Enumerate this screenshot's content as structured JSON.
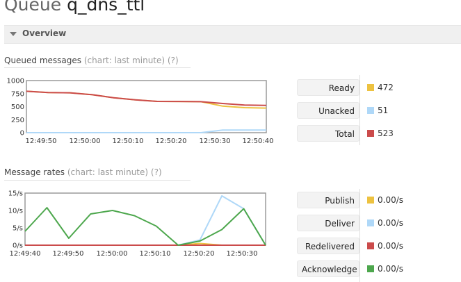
{
  "page": {
    "title_prefix": "Queue",
    "queue_name": "q_dns_ttl"
  },
  "overview": {
    "label": "Overview"
  },
  "queued": {
    "heading": "Queued messages",
    "chart_note": "(chart: last minute)",
    "help": "(?)",
    "legend": [
      {
        "label": "Ready",
        "value": "472",
        "color": "#edc240"
      },
      {
        "label": "Unacked",
        "value": "51",
        "color": "#afd8f8"
      },
      {
        "label": "Total",
        "value": "523",
        "color": "#cb4b4b"
      }
    ]
  },
  "rates": {
    "heading": "Message rates",
    "chart_note": "(chart: last minute)",
    "help": "(?)",
    "legend": [
      {
        "label": "Publish",
        "value": "0.00/s",
        "color": "#edc240"
      },
      {
        "label": "Deliver",
        "value": "0.00/s",
        "color": "#afd8f8"
      },
      {
        "label": "Redelivered",
        "value": "0.00/s",
        "color": "#cb4b4b"
      },
      {
        "label": "Acknowledge",
        "value": "0.00/s",
        "color": "#4da74d"
      }
    ]
  },
  "chart_data": [
    {
      "type": "line",
      "title": "Queued messages",
      "x_ticks": [
        "12:49:50",
        "12:50:00",
        "12:50:10",
        "12:50:20",
        "12:50:30",
        "12:50:40"
      ],
      "y_ticks": [
        "1000",
        "750",
        "500",
        "250",
        "0"
      ],
      "ylim": [
        0,
        1000
      ],
      "x": [
        "12:49:45",
        "12:49:50",
        "12:49:55",
        "12:50:00",
        "12:50:05",
        "12:50:10",
        "12:50:15",
        "12:50:20",
        "12:50:25",
        "12:50:30",
        "12:50:35",
        "12:50:40"
      ],
      "series": [
        {
          "name": "Ready",
          "color": "#edc240",
          "values": [
            795,
            770,
            765,
            730,
            670,
            630,
            600,
            598,
            595,
            510,
            480,
            472
          ]
        },
        {
          "name": "Unacked",
          "color": "#afd8f8",
          "values": [
            0,
            0,
            0,
            0,
            0,
            0,
            0,
            0,
            0,
            51,
            51,
            51
          ]
        },
        {
          "name": "Total",
          "color": "#cb4b4b",
          "values": [
            795,
            770,
            765,
            730,
            670,
            630,
            600,
            598,
            595,
            560,
            530,
            523
          ]
        }
      ],
      "grid": false
    },
    {
      "type": "line",
      "title": "Message rates",
      "x_ticks": [
        "12:49:40",
        "12:49:50",
        "12:50:00",
        "12:50:10",
        "12:50:20",
        "12:50:30"
      ],
      "y_ticks": [
        "15/s",
        "10/s",
        "5/s",
        "0/s"
      ],
      "ylim": [
        0,
        15
      ],
      "x": [
        "12:49:40",
        "12:49:45",
        "12:49:50",
        "12:49:55",
        "12:50:00",
        "12:50:05",
        "12:50:10",
        "12:50:15",
        "12:50:20",
        "12:50:25",
        "12:50:30",
        "12:50:35"
      ],
      "series": [
        {
          "name": "Publish",
          "color": "#edc240",
          "values": [
            0,
            0,
            0,
            0,
            0,
            0,
            0,
            0,
            0.5,
            0,
            0,
            0
          ]
        },
        {
          "name": "Deliver",
          "color": "#afd8f8",
          "values": [
            0,
            0,
            0,
            0,
            0,
            0,
            0,
            0,
            1.5,
            14.2,
            10.5,
            0
          ]
        },
        {
          "name": "Redelivered",
          "color": "#cb4b4b",
          "values": [
            0,
            0,
            0,
            0,
            0,
            0,
            0,
            0,
            0,
            0,
            0,
            0
          ]
        },
        {
          "name": "Acknowledge",
          "color": "#4da74d",
          "values": [
            4,
            10.8,
            2,
            9,
            10,
            8.5,
            5.5,
            0,
            1.2,
            4.5,
            10.5,
            0
          ]
        }
      ],
      "grid": false
    }
  ]
}
